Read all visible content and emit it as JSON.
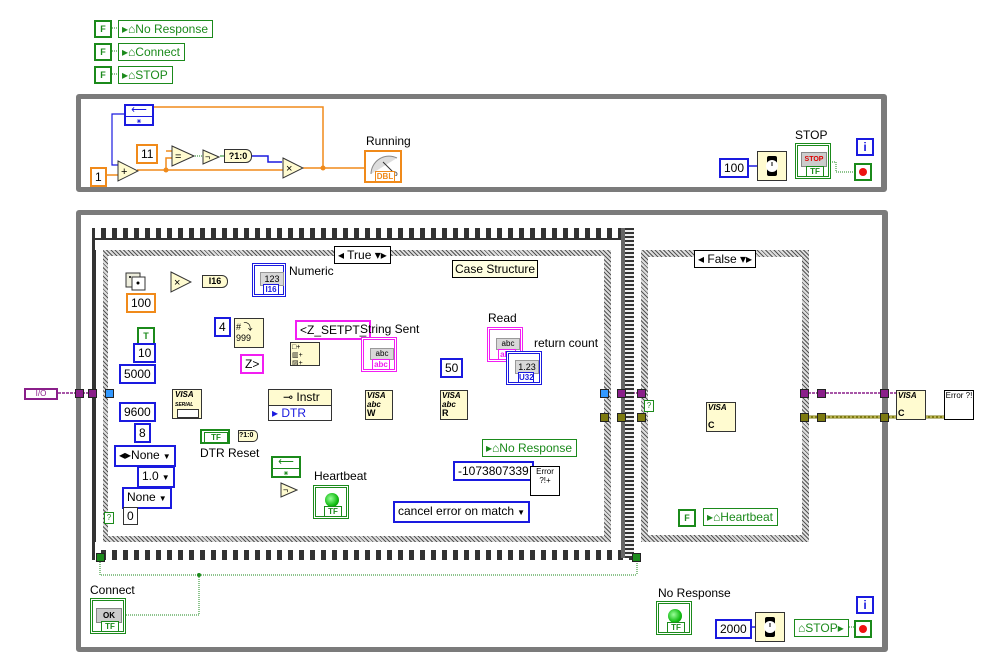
{
  "init_locals": [
    {
      "const": "F",
      "label": "No Response"
    },
    {
      "const": "F",
      "label": "Connect"
    },
    {
      "const": "F",
      "label": "STOP"
    }
  ],
  "top_loop": {
    "shift_register": "",
    "const_one": "1",
    "const_eleven": "11",
    "add_op": "+",
    "eq_op": "=",
    "not_op": "¬",
    "bool_to_num": "?1:0",
    "mult_op": "×",
    "gauge_label": "Running",
    "gauge_type": "DBL",
    "wait_ms": "100",
    "stop_label": "STOP",
    "stop_button_text": "STOP",
    "stop_type": "TF",
    "iteration": "i"
  },
  "bottom_loop": {
    "visa_resource": "I/O",
    "true_case": {
      "selector": "True",
      "tooltip": "Case Structure",
      "random_multiplier": "100",
      "convert_type": "I16",
      "numeric_label": "Numeric",
      "numeric_display": "123",
      "numeric_type": "I16",
      "width_const": "4",
      "format_string": "<Z_SETPT_",
      "suffix_string": "Z>",
      "string_sent_label": "String Sent",
      "string_display": "abc",
      "string_type": "abc",
      "serial_consts": {
        "termchar_enable": "T",
        "timeout": "10",
        "baud_limit": "5000",
        "baud_rate": "9600",
        "data_bits": "8",
        "parity": "None",
        "stop_bits": "1.0",
        "flow_control": "None",
        "zero": "0"
      },
      "visa_serial_label": "VISA SERIAL",
      "property_node_class": "Instr",
      "property_node_prop": "DTR State",
      "dtr_reset_label": "DTR Reset",
      "dtr_bool": "TF",
      "dtr_convert": "?1:0",
      "write_node": "W",
      "read_node": "R",
      "read_count": "50",
      "read_label": "Read",
      "read_display": "abc",
      "return_count_label": "return count",
      "return_count_display": "1.23",
      "return_count_type": "U32",
      "no_response_local": "No Response",
      "error_code": "-1073807339",
      "error_node": "Error ?!+",
      "cancel_mode": "cancel error on match",
      "heartbeat_label": "Heartbeat",
      "heartbeat_type": "TF"
    },
    "false_case": {
      "selector": "False",
      "close_node": "C",
      "heartbeat_const": "F",
      "heartbeat_local": "Heartbeat"
    },
    "connect_label": "Connect",
    "connect_button": "OK",
    "connect_type": "TF",
    "no_response_label": "No Response",
    "no_response_type": "TF",
    "wait_ms": "2000",
    "stop_local": "STOP",
    "iteration": "i",
    "final_close": "C",
    "error_handler": "Error ?!"
  }
}
